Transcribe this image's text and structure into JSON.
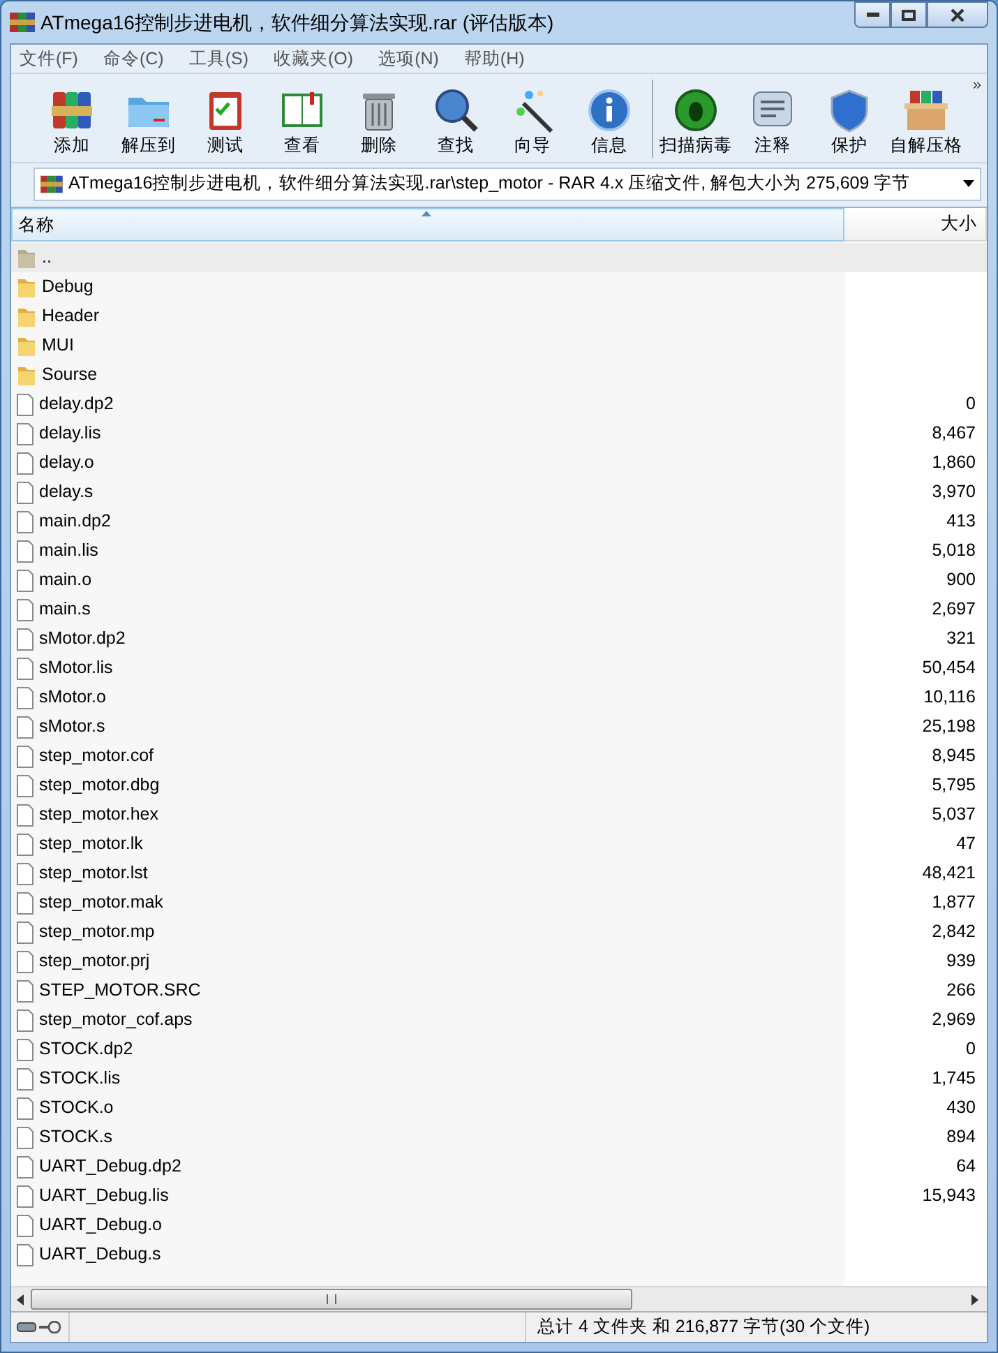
{
  "window": {
    "title": "ATmega16控制步进电机，软件细分算法实现.rar (评估版本)"
  },
  "menu": [
    "文件(F)",
    "命令(C)",
    "工具(S)",
    "收藏夹(O)",
    "选项(N)",
    "帮助(H)"
  ],
  "toolbar": [
    {
      "label": "添加"
    },
    {
      "label": "解压到"
    },
    {
      "label": "测试"
    },
    {
      "label": "查看"
    },
    {
      "label": "删除"
    },
    {
      "label": "查找"
    },
    {
      "label": "向导"
    },
    {
      "label": "信息"
    },
    {
      "label": "扫描病毒"
    },
    {
      "label": "注释"
    },
    {
      "label": "保护"
    },
    {
      "label": "自解压格"
    }
  ],
  "toolbar_more": "»",
  "address": "ATmega16控制步进电机，软件细分算法实现.rar\\step_motor - RAR 4.x 压缩文件, 解包大小为 275,609 字节",
  "columns": [
    "名称",
    "大小"
  ],
  "rows": [
    {
      "kind": "up",
      "name": "..",
      "selected": true
    },
    {
      "kind": "folder",
      "name": "Debug",
      "selected": false
    },
    {
      "kind": "folder",
      "name": "Header",
      "selected": false
    },
    {
      "kind": "folder",
      "name": "MUI",
      "selected": false
    },
    {
      "kind": "folder",
      "name": "Sourse",
      "selected": false
    },
    {
      "kind": "file",
      "name": "delay.dp2",
      "size": "0",
      "selected": false
    },
    {
      "kind": "file",
      "name": "delay.lis",
      "size": "8,467",
      "selected": false
    },
    {
      "kind": "file",
      "name": "delay.o",
      "size": "1,860",
      "selected": false
    },
    {
      "kind": "file",
      "name": "delay.s",
      "size": "3,970",
      "selected": false
    },
    {
      "kind": "file",
      "name": "main.dp2",
      "size": "413",
      "selected": false
    },
    {
      "kind": "file",
      "name": "main.lis",
      "size": "5,018",
      "selected": false
    },
    {
      "kind": "file",
      "name": "main.o",
      "size": "900",
      "selected": false
    },
    {
      "kind": "file",
      "name": "main.s",
      "size": "2,697",
      "selected": false
    },
    {
      "kind": "file",
      "name": "sMotor.dp2",
      "size": "321",
      "selected": false
    },
    {
      "kind": "file",
      "name": "sMotor.lis",
      "size": "50,454",
      "selected": false
    },
    {
      "kind": "file",
      "name": "sMotor.o",
      "size": "10,116",
      "selected": false
    },
    {
      "kind": "file",
      "name": "sMotor.s",
      "size": "25,198",
      "selected": false
    },
    {
      "kind": "file",
      "name": "step_motor.cof",
      "size": "8,945",
      "selected": false
    },
    {
      "kind": "file",
      "name": "step_motor.dbg",
      "size": "5,795",
      "selected": false
    },
    {
      "kind": "file",
      "name": "step_motor.hex",
      "size": "5,037",
      "selected": false
    },
    {
      "kind": "file",
      "name": "step_motor.lk",
      "size": "47",
      "selected": false
    },
    {
      "kind": "file",
      "name": "step_motor.lst",
      "size": "48,421",
      "selected": false
    },
    {
      "kind": "file",
      "name": "step_motor.mak",
      "size": "1,877",
      "selected": false
    },
    {
      "kind": "file",
      "name": "step_motor.mp",
      "size": "2,842",
      "selected": false
    },
    {
      "kind": "file",
      "name": "step_motor.prj",
      "size": "939",
      "selected": false
    },
    {
      "kind": "file",
      "name": "STEP_MOTOR.SRC",
      "size": "266",
      "selected": false
    },
    {
      "kind": "file",
      "name": "step_motor_cof.aps",
      "size": "2,969",
      "selected": false
    },
    {
      "kind": "file",
      "name": "STOCK.dp2",
      "size": "0",
      "selected": false
    },
    {
      "kind": "file",
      "name": "STOCK.lis",
      "size": "1,745",
      "selected": false
    },
    {
      "kind": "file",
      "name": "STOCK.o",
      "size": "430",
      "selected": false
    },
    {
      "kind": "file",
      "name": "STOCK.s",
      "size": "894",
      "selected": false
    },
    {
      "kind": "file",
      "name": "UART_Debug.dp2",
      "size": "64",
      "selected": false
    },
    {
      "kind": "file",
      "name": "UART_Debug.lis",
      "size": "15,943",
      "selected": false
    },
    {
      "kind": "file",
      "name": "UART_Debug.o",
      "selected": false
    },
    {
      "kind": "file",
      "name": "UART_Debug.s",
      "selected": false
    }
  ],
  "status_bar": "总计 4 文件夹 和 216,877 字节(30 个文件)"
}
